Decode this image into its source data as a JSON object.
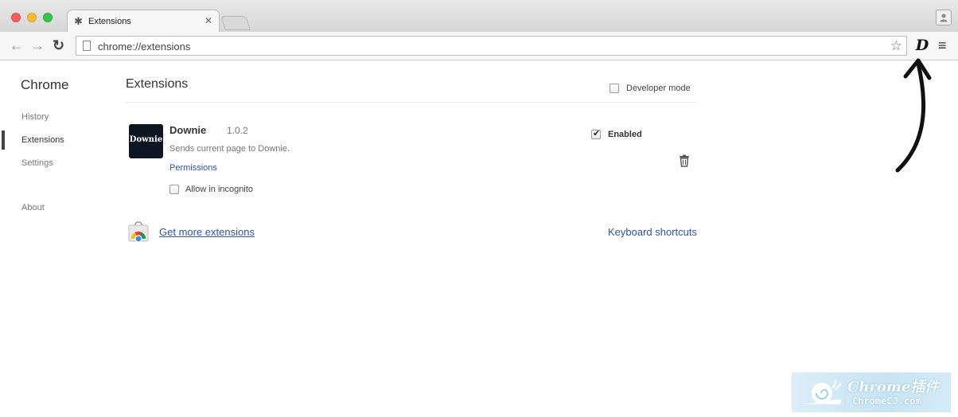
{
  "browser": {
    "tab_title": "Extensions",
    "url": "chrome://extensions",
    "extension_action_icon": "D"
  },
  "sidebar": {
    "title": "Chrome",
    "items": [
      {
        "label": "History"
      },
      {
        "label": "Extensions",
        "active": true
      },
      {
        "label": "Settings"
      },
      {
        "label": "About"
      }
    ]
  },
  "main": {
    "title": "Extensions",
    "developer_mode_label": "Developer mode",
    "developer_mode_checked": false,
    "extension": {
      "logo_text": "Downie",
      "name": "Downie",
      "version": "1.0.2",
      "description": "Sends current page to Downie.",
      "permissions_link": "Permissions",
      "incognito_label": "Allow in incognito",
      "incognito_checked": false,
      "enabled_label": "Enabled",
      "enabled_checked": true
    },
    "get_more_link": "Get more extensions",
    "keyboard_shortcuts_link": "Keyboard shortcuts"
  },
  "watermark": {
    "line1": "Chrome插件",
    "line2": "ChromeCJ.com"
  },
  "colors": {
    "link": "#2a52be",
    "close_button": "#fc5b57",
    "minimize_button": "#fdbc2f",
    "zoom_button": "#33c748",
    "extension_logo_bg": "#0e1622"
  },
  "icons": {
    "tab": "puzzle-icon",
    "back": "back-arrow-icon",
    "forward": "forward-arrow-icon",
    "reload": "reload-icon",
    "bookmark": "star-icon",
    "menu": "hamburger-icon",
    "delete": "trash-icon",
    "store": "web-store-icon"
  }
}
